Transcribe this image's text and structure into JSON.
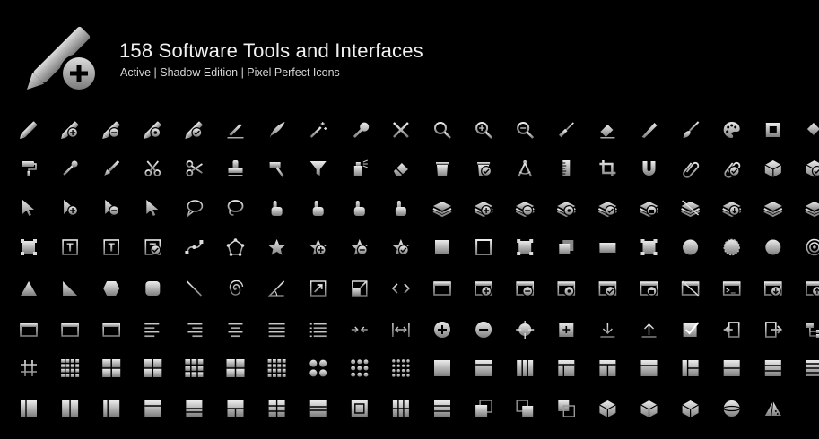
{
  "header": {
    "title": "158 Software Tools and Interfaces",
    "subtitle": "Active | Shadow Edition | Pixel Perfect Icons"
  },
  "colors": {
    "background": "#000000",
    "icon_light": "#e6e6e6",
    "icon_dark": "#8a8a8a",
    "text": "#f2f2f2"
  },
  "logo_icon": "pencil-add-icon",
  "rows": [
    [
      "pencil-icon",
      "pencil-add-icon",
      "pencil-remove-icon",
      "pencil-star-icon",
      "pencil-check-icon",
      "pen-line-icon",
      "quill-icon",
      "magic-wand-icon",
      "wrench-icon",
      "tools-cross-icon",
      "search-icon",
      "zoom-in-icon",
      "zoom-out-icon",
      "screwdriver-icon",
      "eraser-line-icon",
      "saw-icon",
      "brush-icon",
      "palette-icon",
      "frame-icon",
      "paint-bucket-icon"
    ],
    [
      "paint-roller-icon",
      "dropper-icon",
      "wide-brush-icon",
      "scissors-icon",
      "scissors-cut-icon",
      "stamp-icon",
      "hammer-icon",
      "funnel-icon",
      "spray-can-icon",
      "eraser-icon",
      "trash-icon",
      "trash-check-icon",
      "compass-icon",
      "ruler-icon",
      "crop-icon",
      "magnet-icon",
      "paperclip-icon",
      "paperclip-check-icon",
      "cube-icon",
      "cube-check-icon"
    ],
    [
      "cursor-icon",
      "cursor-plus-icon",
      "cursor-minus-icon",
      "cursor-outline-icon",
      "speech-lasso-icon",
      "lasso-icon",
      "hand-pointer-icon",
      "hand-point-icon",
      "hand-grab-icon",
      "hand-tap-icon",
      "layers-icon",
      "layers-add-icon",
      "layers-remove-icon",
      "layers-star-icon",
      "layers-check-icon",
      "layers-lock-icon",
      "layers-hidden-icon",
      "layers-down-icon",
      "layers-merge-icon",
      "layers-stack-icon"
    ],
    [
      "selection-box-icon",
      "text-box-icon",
      "text-icon",
      "text-check-icon",
      "bezier-icon",
      "polygon-path-icon",
      "star-icon",
      "star-add-icon",
      "star-remove-icon",
      "star-check-icon",
      "square-icon",
      "square-outline-icon",
      "square-select-icon",
      "square-overlap-icon",
      "rectangle-icon",
      "rectangle-select-icon",
      "circle-icon",
      "circle-dashed-icon",
      "circles-overlap-icon",
      "circle-target-icon"
    ],
    [
      "triangle-icon",
      "right-triangle-icon",
      "hexagon-icon",
      "rounded-square-icon",
      "line-icon",
      "spiral-icon",
      "angle-icon",
      "resize-arrow-icon",
      "shrink-arrow-icon",
      "code-icon",
      "window-icon",
      "window-add-icon",
      "window-remove-icon",
      "window-star-icon",
      "window-check-icon",
      "window-lock-icon",
      "window-hidden-icon",
      "window-terminal-icon",
      "window-download-icon",
      "window-upload-icon"
    ],
    [
      "window-nested-icon",
      "windows-stack-icon",
      "windows-cascade-icon",
      "align-left-icon",
      "align-right-icon",
      "align-center-icon",
      "align-justify-icon",
      "list-icon",
      "collapse-horizontal-icon",
      "expand-horizontal-icon",
      "plus-circle-icon",
      "minus-circle-icon",
      "crosshair-icon",
      "focus-frame-icon",
      "download-icon",
      "upload-icon",
      "checkbox-icon",
      "import-icon",
      "export-icon",
      "hierarchy-icon"
    ],
    [
      "hash-grid-icon",
      "grid-fine-icon",
      "grid-2x2-icon",
      "split-vertical-icon",
      "grid-3x3-icon",
      "grid-2x2-large-icon",
      "grid-4x4-icon",
      "dot-grid-icon",
      "dot-grid-sparse-icon",
      "dot-grid-dense-icon",
      "panel-solid-icon",
      "panel-header-icon",
      "layout-columns-icon",
      "layout-header-sidebar-icon",
      "layout-t-icon",
      "layout-header-icon",
      "layout-sidebar-grid-icon",
      "layout-split-horizontal-icon",
      "layout-rows-icon",
      "layout-stripes-icon"
    ],
    [
      "split-left-icon",
      "split-columns-icon",
      "split-right-icon",
      "layout-top-bar-icon",
      "layout-bottom-rows-icon",
      "layout-lower-split-icon",
      "layout-quad-rows-icon",
      "layout-band-icon",
      "layout-frame-icon",
      "layout-grid-cells-icon",
      "layout-thirds-icon",
      "copy-layers-icon",
      "bring-front-icon",
      "send-back-icon",
      "cube-front-icon",
      "cube-side-icon",
      "cube-wire-icon",
      "sphere-cut-icon",
      "pyramid-icon"
    ]
  ]
}
